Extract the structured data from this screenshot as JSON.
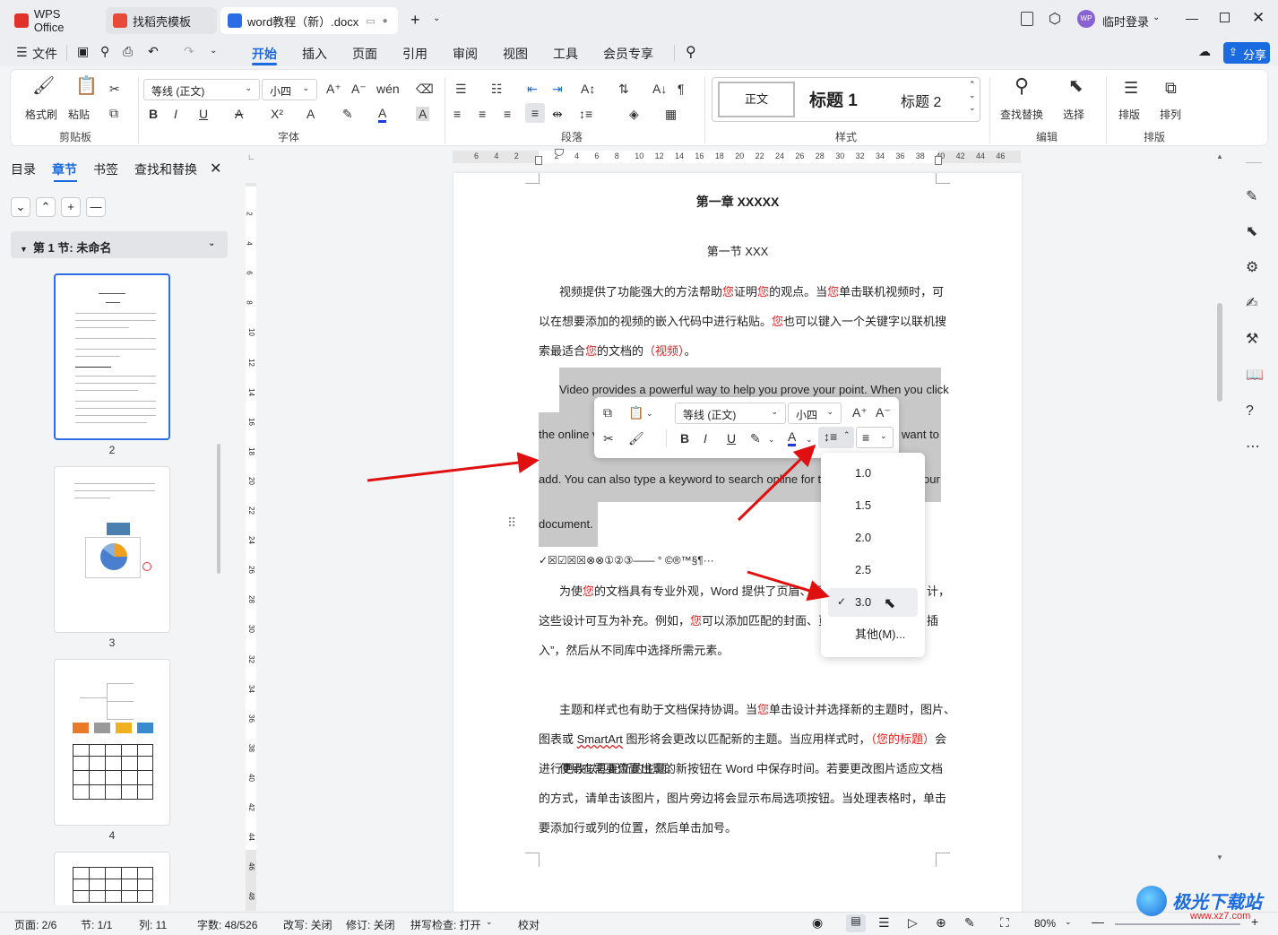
{
  "titlebar": {
    "tabs": [
      {
        "label": "WPS Office",
        "icon": "wps-logo-icon",
        "color": "#e0312b"
      },
      {
        "label": "找稻壳模板",
        "icon": "docer-icon",
        "color": "#e84a3a"
      },
      {
        "label": "word教程（新）.docx",
        "icon": "word-doc-icon",
        "color": "#2b6de5"
      }
    ],
    "login_label": "临时登录",
    "avatar_text": "WP"
  },
  "menubar": {
    "file_label": "文件",
    "items": [
      "开始",
      "插入",
      "页面",
      "引用",
      "审阅",
      "视图",
      "工具",
      "会员专享"
    ],
    "active": "开始",
    "share_label": "分享"
  },
  "ribbon": {
    "clipboard": {
      "format_painter": "格式刷",
      "paste": "粘贴",
      "group": "剪贴板"
    },
    "font": {
      "family": "等线 (正文)",
      "size": "小四",
      "group": "字体"
    },
    "paragraph": {
      "group": "段落"
    },
    "styles": {
      "normal": "正文",
      "h1": "标题  1",
      "h2": "标题  2",
      "group": "样式"
    },
    "edit": {
      "find": "查找替换",
      "select": "选择",
      "group": "编辑"
    },
    "arrange": {
      "layout": "排版",
      "order": "排列",
      "group": "排版"
    }
  },
  "leftpanel": {
    "tabs": [
      "目录",
      "章节",
      "书签",
      "查找和替换"
    ],
    "active_tab": "章节",
    "section_label": "第 1 节: 未命名",
    "pages": [
      "2",
      "3",
      "4"
    ]
  },
  "ruler": {
    "h_ticks": [
      "6",
      "4",
      "2",
      "",
      "2",
      "4",
      "6",
      "8",
      "10",
      "12",
      "14",
      "16",
      "18",
      "20",
      "22",
      "24",
      "26",
      "28",
      "30",
      "32",
      "34",
      "36",
      "38",
      "40",
      "42",
      "44",
      "46"
    ],
    "v_ticks": [
      "2",
      "4",
      "6",
      "8",
      "10",
      "12",
      "14",
      "16",
      "18",
      "20",
      "22",
      "24",
      "26",
      "28",
      "30",
      "32",
      "34",
      "36",
      "38",
      "40",
      "42",
      "44",
      "46",
      "48"
    ]
  },
  "document": {
    "chapter": "第一章  XXXXX",
    "section": "第一节  XXX",
    "p1_lines": [
      [
        [
          "视频提供了功能强大的方法帮助",
          0
        ],
        [
          "您",
          1
        ],
        [
          "证明",
          0
        ],
        [
          "您",
          1
        ],
        [
          "的观点。当",
          0
        ],
        [
          "您",
          1
        ],
        [
          "单击联机视频时，可",
          0
        ]
      ],
      [
        [
          "以在想要添加的视频的嵌入代码中进行粘贴。",
          0
        ],
        [
          "您",
          1
        ],
        [
          "也可以键入一个关键字以联机搜",
          0
        ]
      ],
      [
        [
          "索最适合",
          0
        ],
        [
          "您",
          1
        ],
        [
          "的文档的",
          0
        ],
        [
          "（视频）",
          1
        ],
        [
          "。",
          0
        ]
      ]
    ],
    "en_lines": [
      "Video provides a powerful way to help you prove your point. When you click",
      "the online v",
      "want to",
      "add. You can also type a keyword to search online for the",
      "our",
      "document."
    ],
    "symbols": "✓☒☑☒☒⊗⊗①②③——    °  ©®™§¶···",
    "p2_lines": [
      [
        [
          "为使",
          0
        ],
        [
          "您",
          1
        ],
        [
          "的文档具有专业外观，Word  提供了页眉、页",
          0
        ]
      ],
      [
        [
          "这些设计可互为补充。例如，",
          0
        ],
        [
          "您",
          1
        ],
        [
          "可以添加匹配的封面、页",
          0
        ]
      ],
      [
        [
          "入”，然后从不同库中选择所需元素。",
          0
        ]
      ]
    ],
    "p2_tails": [
      "计，",
      "插"
    ],
    "p3_lines": [
      [
        [
          "主题和样式也有助于文档保持协调。当",
          0
        ],
        [
          "您",
          1
        ],
        [
          "单击设计并选择新的主题时，图片、",
          0
        ]
      ],
      [
        [
          "图表或  ",
          0
        ],
        [
          "SmartArt",
          2
        ],
        [
          "  图形将会更改以匹配新的主题。当应用样式时，",
          0
        ],
        [
          "（您的标题）",
          1
        ],
        [
          "会",
          0
        ]
      ],
      [
        [
          "进行更改以匹配新的主题。",
          0
        ]
      ]
    ],
    "p4_lines": [
      [
        [
          "使用在需要位置出现的新按钮在  Word  中保存时间。若要更改图片适应文档",
          0
        ]
      ],
      [
        [
          "的方式，请单击该图片，图片旁边将会显示布局选项按钮。当处理表格时，单击",
          0
        ]
      ],
      [
        [
          "要添加行或列的位置，然后单击加号。",
          0
        ]
      ]
    ]
  },
  "floatbar": {
    "font": "等线 (正文)",
    "size": "小四"
  },
  "line_spacing_menu": {
    "options": [
      "1.0",
      "1.5",
      "2.0",
      "2.5",
      "3.0",
      "其他(M)..."
    ],
    "selected": "3.0"
  },
  "statusbar": {
    "page": "页面: 2/6",
    "section": "节: 1/1",
    "column": "列: 11",
    "words": "字数: 48/526",
    "revise_mode": "改写: 关闭",
    "track": "修订: 关闭",
    "spell": "拼写检查: 打开",
    "proof": "校对",
    "zoom": "80%"
  },
  "watermark": {
    "text": "极光下载站",
    "url": "www.xz7.com"
  },
  "colors": {
    "accent": "#1a6be0",
    "red_text": "#e02020",
    "arrow": "#e01010",
    "selection": "#c8c8c8"
  }
}
